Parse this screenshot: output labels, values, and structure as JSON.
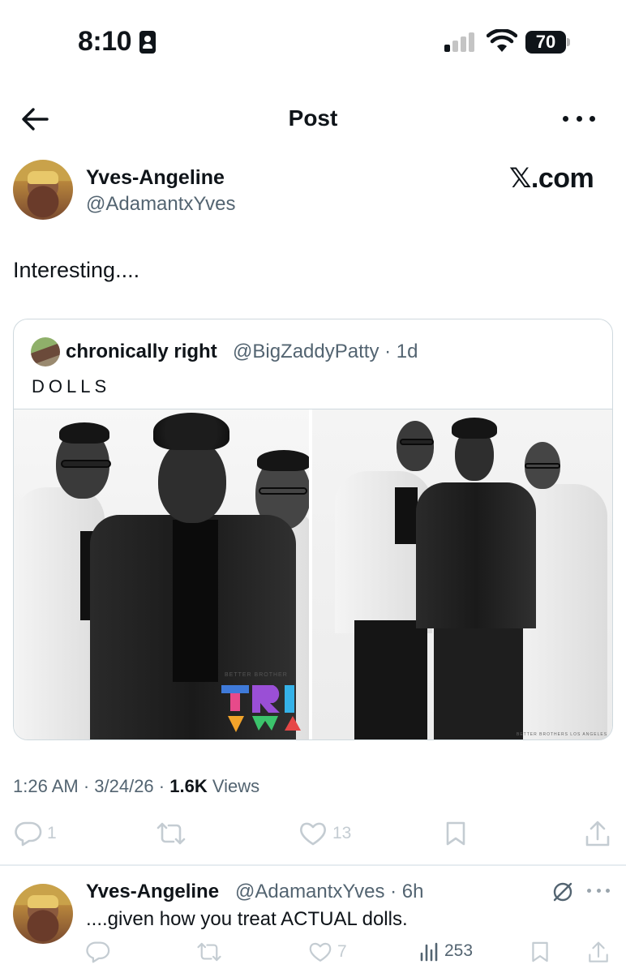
{
  "status_bar": {
    "time": "8:10",
    "battery": "70"
  },
  "header": {
    "title": "Post"
  },
  "post": {
    "author_name": "Yves-Angeline",
    "author_handle": "@AdamantxYves",
    "watermark": "𝕏.com",
    "text": "Interesting....",
    "timestamp": "1:26 AM · 3/24/26 · ",
    "views_count": "1.6K",
    "views_label": " Views",
    "actions": {
      "reply_count": "1",
      "like_count": "13"
    }
  },
  "quote": {
    "author_name": "chronically right",
    "author_handle_time": "@BigZaddyPatty · 1d",
    "text": "DOLLS",
    "image_left_caption": "TRI",
    "image_left_small": "BETTER BROTHER",
    "image_right_caption": "BETTER BROTHERS LOS ANGELES"
  },
  "reply": {
    "author_name": "Yves-Angeline",
    "author_handle_time": "@AdamantxYves · 6h",
    "text": "....given how you treat ACTUAL dolls.",
    "actions": {
      "like_count": "7",
      "views_count": "253"
    }
  },
  "icons": {
    "back": "arrow-left-icon",
    "more": "more-horizontal-icon",
    "reply": "comment-icon",
    "repost": "repost-icon",
    "like": "heart-icon",
    "bookmark": "bookmark-icon",
    "share": "share-icon",
    "views": "bar-chart-icon",
    "grok": "grok-icon"
  },
  "colors": {
    "text": "#0f1419",
    "secondary": "#536471",
    "action_gray": "#c4ccd2",
    "border": "#cfd9de"
  }
}
